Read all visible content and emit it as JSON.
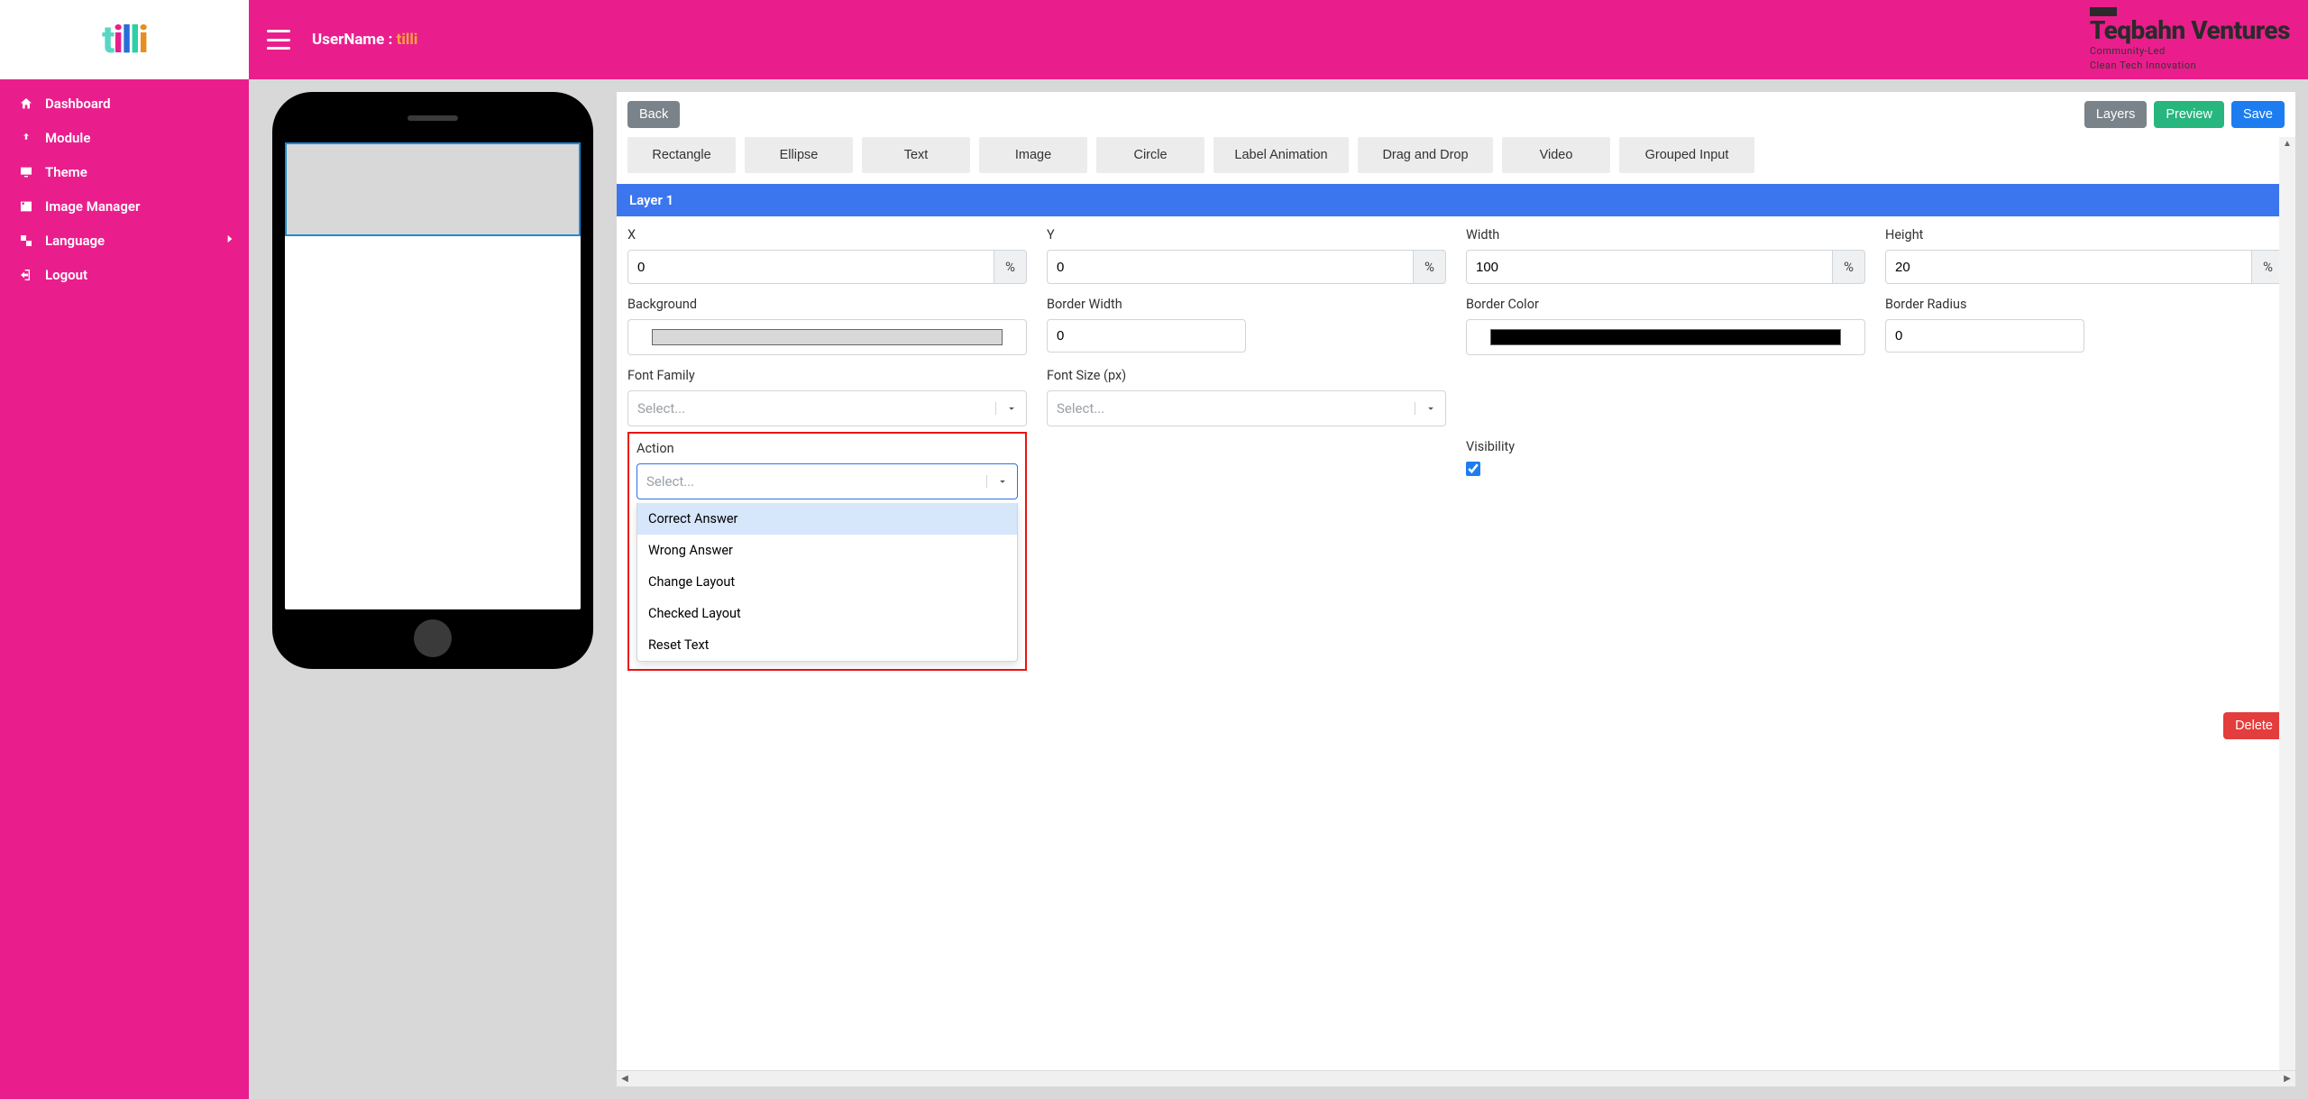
{
  "sidebar": {
    "logo_text": "tilli",
    "items": [
      {
        "label": "Dashboard",
        "icon": "home"
      },
      {
        "label": "Module",
        "icon": "upload"
      },
      {
        "label": "Theme",
        "icon": "monitor"
      },
      {
        "label": "Image Manager",
        "icon": "image"
      },
      {
        "label": "Language",
        "icon": "translate",
        "has_submenu": true
      },
      {
        "label": "Logout",
        "icon": "logout"
      }
    ]
  },
  "topbar": {
    "username_label": "UserName : ",
    "username_value": "tilli",
    "brand_name": "Teqbahn Ventures",
    "brand_sub_1": "Community-Led",
    "brand_sub_2": "Clean Tech Innovation"
  },
  "panel": {
    "back": "Back",
    "layers": "Layers",
    "preview": "Preview",
    "save": "Save",
    "delete": "Delete",
    "shapes": [
      "Rectangle",
      "Ellipse",
      "Text",
      "Image",
      "Circle",
      "Label Animation",
      "Drag and Drop",
      "Video",
      "Grouped Input"
    ],
    "layer_header": "Layer 1",
    "props": {
      "x": {
        "label": "X",
        "value": "0",
        "unit": "%"
      },
      "y": {
        "label": "Y",
        "value": "0",
        "unit": "%"
      },
      "width": {
        "label": "Width",
        "value": "100",
        "unit": "%"
      },
      "height": {
        "label": "Height",
        "value": "20",
        "unit": "%"
      },
      "background": {
        "label": "Background",
        "value": "#d8d8d8"
      },
      "border_width": {
        "label": "Border Width",
        "value": "0"
      },
      "border_color": {
        "label": "Border Color",
        "value": "#000000"
      },
      "border_radius": {
        "label": "Border Radius",
        "value": "0"
      },
      "font_family": {
        "label": "Font Family",
        "placeholder": "Select..."
      },
      "font_size": {
        "label": "Font Size (px)",
        "placeholder": "Select..."
      },
      "action": {
        "label": "Action",
        "placeholder": "Select...",
        "options": [
          "Correct Answer",
          "Wrong Answer",
          "Change Layout",
          "Checked Layout",
          "Reset Text"
        ]
      },
      "visibility": {
        "label": "Visibility",
        "checked": true
      }
    }
  }
}
